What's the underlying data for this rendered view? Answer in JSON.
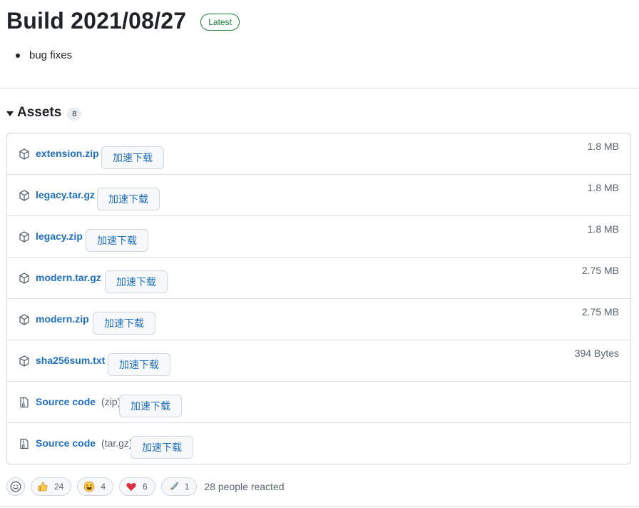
{
  "release": {
    "title": "Build 2021/08/27",
    "badge": "Latest",
    "notes": [
      "bug fixes"
    ]
  },
  "assets": {
    "title": "Assets",
    "count": "8",
    "download_label": "加速下载",
    "items": [
      {
        "name": "extension.zip",
        "suffix": "",
        "size": "1.8 MB",
        "icon": "package-icon"
      },
      {
        "name": "legacy.tar.gz",
        "suffix": "",
        "size": "1.8 MB",
        "icon": "package-icon"
      },
      {
        "name": "legacy.zip",
        "suffix": "",
        "size": "1.8 MB",
        "icon": "package-icon"
      },
      {
        "name": "modern.tar.gz",
        "suffix": "",
        "size": "2.75 MB",
        "icon": "package-icon"
      },
      {
        "name": "modern.zip",
        "suffix": "",
        "size": "2.75 MB",
        "icon": "package-icon"
      },
      {
        "name": "sha256sum.txt",
        "suffix": "",
        "size": "394 Bytes",
        "icon": "package-icon"
      },
      {
        "name": "Source code",
        "suffix": "(zip)",
        "size": "",
        "icon": "file-zip-icon"
      },
      {
        "name": "Source code",
        "suffix": "(tar.gz)",
        "size": "",
        "icon": "file-zip-icon"
      }
    ]
  },
  "reactions": {
    "items": [
      {
        "emoji": "thumbs-up-icon",
        "count": "24"
      },
      {
        "emoji": "laugh-icon",
        "count": "4"
      },
      {
        "emoji": "heart-icon",
        "count": "6"
      },
      {
        "emoji": "rocket-icon",
        "count": "1"
      }
    ],
    "summary": "28 people reacted"
  },
  "colors": {
    "link": "#1f6fbf",
    "latest_badge": "#1a7f37",
    "border": "#d0d7de"
  }
}
